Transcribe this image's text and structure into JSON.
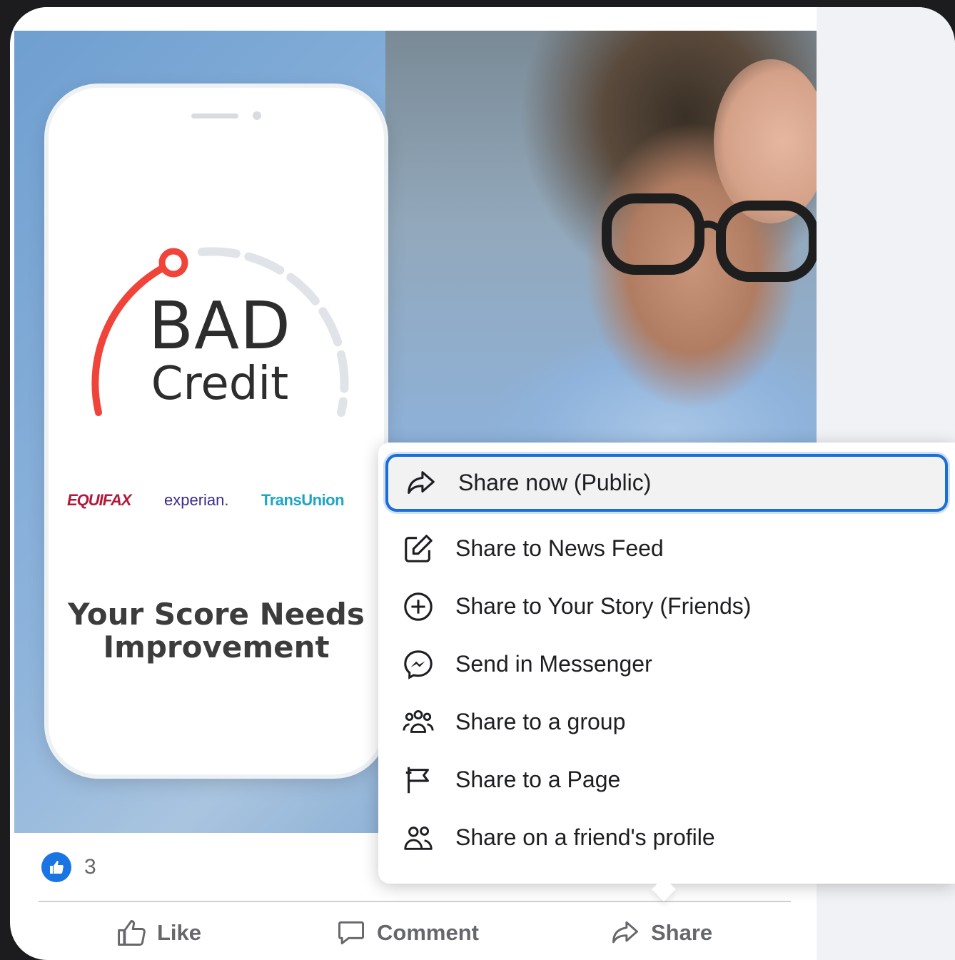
{
  "post": {
    "image": {
      "phone": {
        "headline": "BAD",
        "subheadline": "Credit",
        "bureaus": [
          "EQUIFAX",
          "experian.",
          "TransUnion"
        ],
        "tagline_line1": "Your Score Needs",
        "tagline_line2": "Improvement"
      }
    },
    "reactions": {
      "icon": "thumbs-up-icon",
      "count": "3"
    },
    "actions": {
      "like": "Like",
      "comment": "Comment",
      "share": "Share"
    }
  },
  "share_menu": {
    "items": [
      {
        "label": "Share now (Public)",
        "icon": "share-arrow-icon",
        "selected": true
      },
      {
        "label": "Share to News Feed",
        "icon": "edit-icon"
      },
      {
        "label": "Share to Your Story (Friends)",
        "icon": "plus-circle-icon"
      },
      {
        "label": "Send in Messenger",
        "icon": "messenger-icon"
      },
      {
        "label": "Share to a group",
        "icon": "group-icon"
      },
      {
        "label": "Share to a Page",
        "icon": "flag-icon"
      },
      {
        "label": "Share on a friend's profile",
        "icon": "friends-icon"
      }
    ]
  },
  "colors": {
    "accent": "#1a6ed8",
    "gauge_red": "#f0443a",
    "text_primary": "#1c1e21",
    "text_secondary": "#65676b"
  }
}
